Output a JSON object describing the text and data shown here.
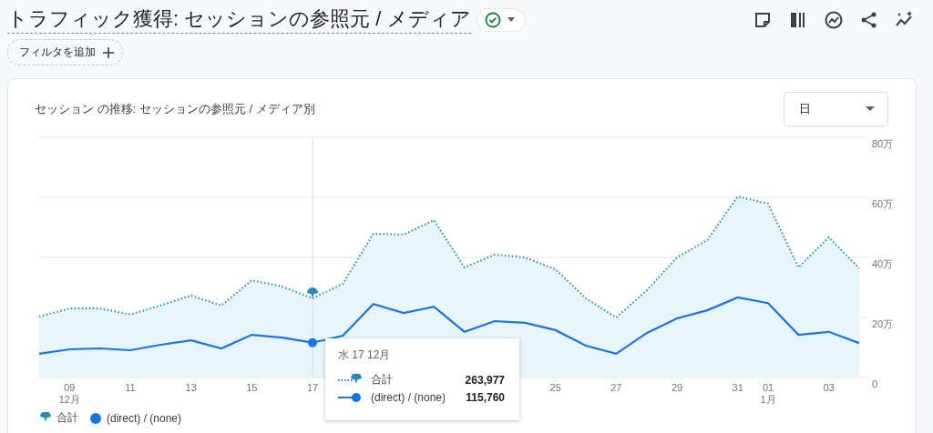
{
  "header": {
    "title": "トラフィック獲得: セッションの参照元 / メディア",
    "status_ok": true
  },
  "filter_button": {
    "label": "フィルタを追加"
  },
  "card": {
    "title": "セッション の推移: セッションの参照元 / メディア別",
    "granularity_select": {
      "value": "日"
    },
    "chart_data": {
      "type": "area",
      "grid": true,
      "categories": [
        null,
        "09\n12月",
        null,
        "11",
        null,
        "13",
        null,
        "15",
        null,
        "17",
        null,
        null,
        null,
        null,
        null,
        null,
        null,
        "25",
        null,
        "27",
        null,
        "29",
        null,
        "31",
        "01\n1月",
        null,
        "03",
        null
      ],
      "series": [
        {
          "name": "合計",
          "color": "#1e8bc3",
          "type": "area",
          "line_style": "dotted",
          "values": [
            20.3,
            23,
            23,
            21,
            24,
            27.3,
            24,
            32.4,
            30.3,
            26.4,
            31.2,
            47.9,
            47.6,
            52.4,
            36.7,
            40.9,
            40,
            36,
            26.4,
            20,
            29,
            40,
            45.8,
            60.3,
            57.9,
            36.7,
            46.7,
            36.4
          ]
        },
        {
          "name": "(direct) / (none)",
          "color": "#1a73e8",
          "type": "line",
          "line_style": "solid",
          "values": [
            7.9,
            9.4,
            9.7,
            9.1,
            10.9,
            12.4,
            9.7,
            14.2,
            13.3,
            11.6,
            13.9,
            24.5,
            21.5,
            23.6,
            15.2,
            18.8,
            18.2,
            15.8,
            10.6,
            7.9,
            14.8,
            19.7,
            22.4,
            26.7,
            24.8,
            14.2,
            15.2,
            11.5
          ]
        }
      ],
      "ylim": [
        0,
        80
      ],
      "yticks": [
        {
          "value": 0,
          "label": "0"
        },
        {
          "value": 20,
          "label": "20万"
        },
        {
          "value": 40,
          "label": "40万"
        },
        {
          "value": 60,
          "label": "60万"
        },
        {
          "value": 80,
          "label": "80万"
        }
      ],
      "annotations": [
        {
          "x": "17"
        }
      ]
    },
    "tooltip": {
      "date": "水 17 12月",
      "rows": [
        {
          "kind": "total",
          "label": "合計",
          "value": "263,977"
        },
        {
          "kind": "series",
          "label": "(direct) / (none)",
          "value": "115,760"
        }
      ]
    }
  }
}
